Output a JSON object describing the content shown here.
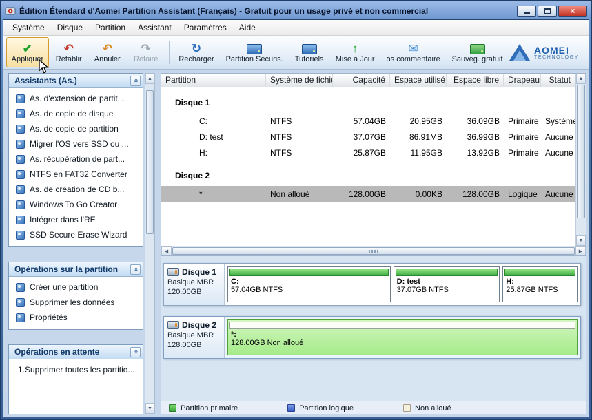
{
  "window": {
    "title": "Édition Étendard d'Aomei Partition Assistant (Français) - Gratuit pour un usage privé et non commercial"
  },
  "icons": {
    "check": "✔",
    "undo": "↶",
    "redo": "↷",
    "refresh": "↻",
    "up": "↑",
    "mail": "✉",
    "collapse": "«",
    "close": "×",
    "scroll_up": "▲",
    "scroll_down": "▼",
    "scroll_left": "◀",
    "scroll_right": "▶"
  },
  "menu": {
    "items": [
      "Système",
      "Disque",
      "Partition",
      "Assistant",
      "Paramètres",
      "Aide"
    ]
  },
  "toolbar": {
    "apply": "Appliquer",
    "restore": "Rétablir",
    "undo": "Annuler",
    "redo": "Refaire",
    "reload": "Recharger",
    "secure": "Partition Sécuris.",
    "tutorials": "Tutoriels",
    "update": "Mise à Jour",
    "feedback": "os commentaire",
    "backup": "Sauveg. gratuit",
    "logo_title": "AOMEI",
    "logo_sub": "TECHNOLOGY"
  },
  "sidebar": {
    "wizards": {
      "title": "Assistants (As.)",
      "items": [
        "As. d'extension de partit...",
        "As. de copie de disque",
        "As. de copie de partition",
        "Migrer l'OS vers SSD ou ...",
        "As. récupération de part...",
        "NTFS en FAT32 Converter",
        "As. de création de CD b...",
        "Windows To Go Creator",
        "Intégrer dans l'RE",
        "SSD Secure Erase Wizard"
      ]
    },
    "partition_ops": {
      "title": "Opérations sur la partition",
      "items": [
        "Créer une partition",
        "Supprimer les données",
        "Propriétés"
      ]
    },
    "pending_ops": {
      "title": "Opérations en attente",
      "items": [
        "1.Supprimer toutes les partitio..."
      ]
    }
  },
  "table": {
    "columns": [
      "Partition",
      "Système de fichier",
      "Capacité",
      "Espace utilisé",
      "Espace libre",
      "Drapeau",
      "Statut"
    ],
    "disk1": {
      "name": "Disque 1",
      "rows": [
        {
          "partition": "C:",
          "fs": "NTFS",
          "capacity": "57.04GB",
          "used": "20.95GB",
          "free": "36.09GB",
          "flag": "Primaire",
          "status": "Système"
        },
        {
          "partition": "D: test",
          "fs": "NTFS",
          "capacity": "37.07GB",
          "used": "86.91MB",
          "free": "36.99GB",
          "flag": "Primaire",
          "status": "Aucune"
        },
        {
          "partition": "H:",
          "fs": "NTFS",
          "capacity": "25.87GB",
          "used": "11.95GB",
          "free": "13.92GB",
          "flag": "Primaire",
          "status": "Aucune"
        }
      ]
    },
    "disk2": {
      "name": "Disque 2",
      "rows": [
        {
          "partition": "*",
          "fs": "Non alloué",
          "capacity": "128.00GB",
          "used": "0.00KB",
          "free": "128.00GB",
          "flag": "Logique",
          "status": "Aucune",
          "selected": true
        }
      ]
    }
  },
  "disks": {
    "disk1": {
      "name": "Disque 1",
      "type": "Basique MBR",
      "size": "120.00GB",
      "partitions": [
        {
          "label": "C:",
          "info": "57.04GB NTFS",
          "width_pct": 47.5,
          "kind": "primary"
        },
        {
          "label": "D: test",
          "info": "37.07GB NTFS",
          "width_pct": 30.9,
          "kind": "primary"
        },
        {
          "label": "H:",
          "info": "25.87GB NTFS",
          "width_pct": 21.6,
          "kind": "primary"
        }
      ]
    },
    "disk2": {
      "name": "Disque 2",
      "type": "Basique MBR",
      "size": "128.00GB",
      "partitions": [
        {
          "label": "*:",
          "info": "128.00GB Non alloué",
          "width_pct": 100,
          "kind": "unallocated",
          "selected": true
        }
      ]
    }
  },
  "legend": {
    "items": [
      {
        "label": "Partition primaire",
        "color": "#3cb44a"
      },
      {
        "label": "Partition logique",
        "color": "#3a5fc8"
      },
      {
        "label": "Non alloué",
        "color": "#f4efdf"
      }
    ]
  }
}
